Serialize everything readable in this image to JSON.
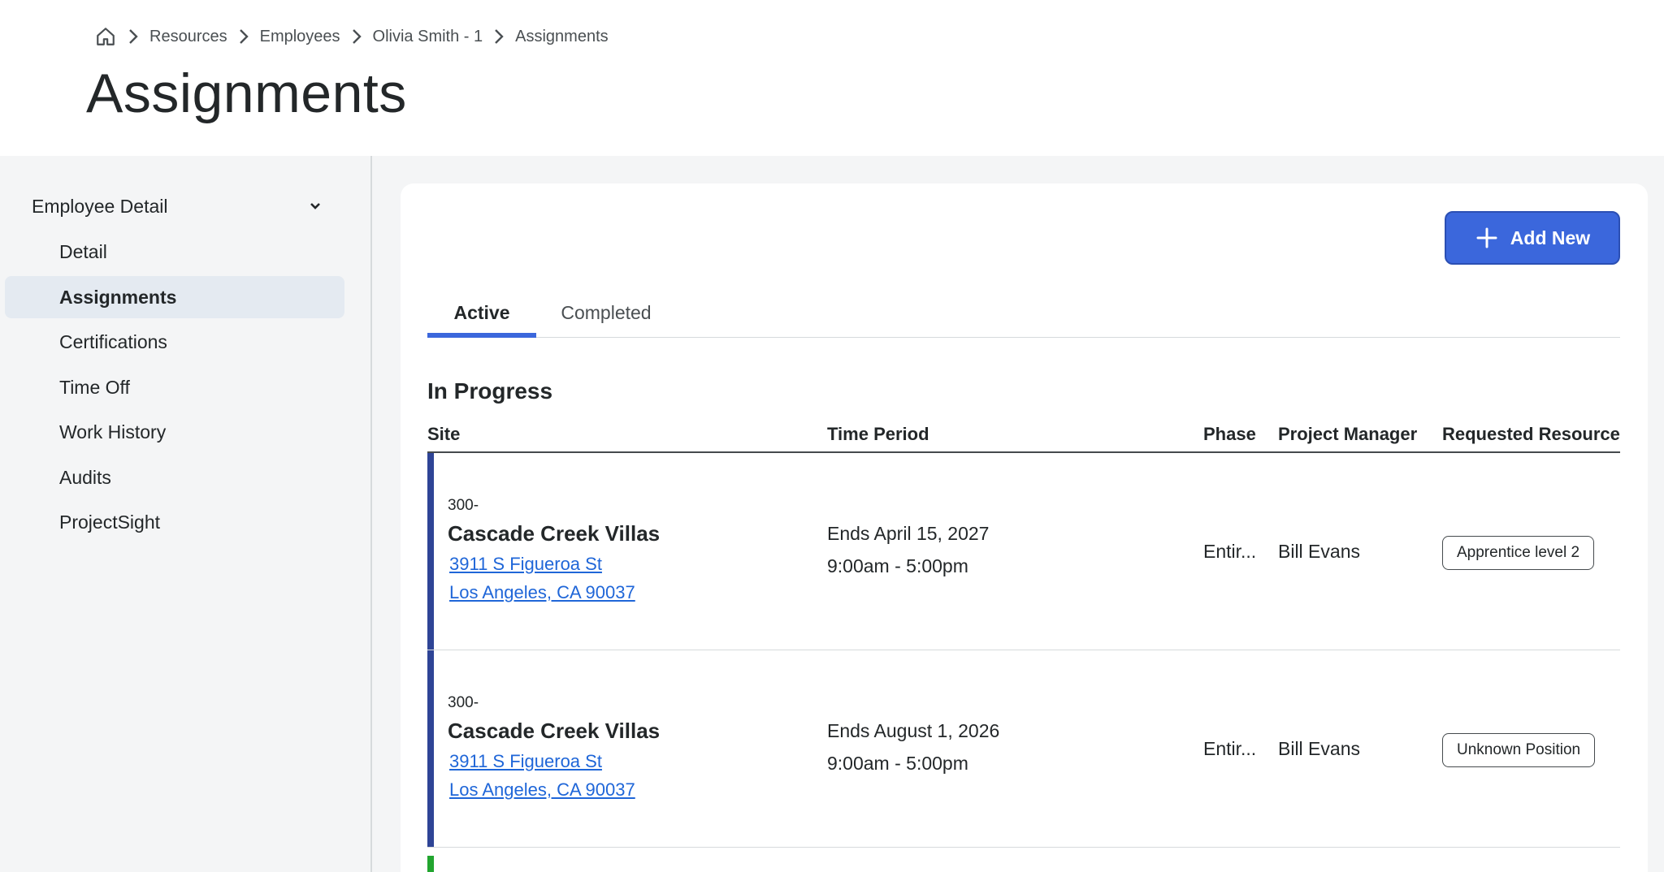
{
  "breadcrumb": {
    "items": [
      "Resources",
      "Employees",
      "Olivia Smith - 1",
      "Assignments"
    ]
  },
  "page": {
    "title": "Assignments"
  },
  "sidebar": {
    "group_label": "Employee Detail",
    "items": [
      {
        "label": "Detail"
      },
      {
        "label": "Assignments",
        "active": true
      },
      {
        "label": "Certifications"
      },
      {
        "label": "Time Off"
      },
      {
        "label": "Work History"
      },
      {
        "label": "Audits"
      },
      {
        "label": "ProjectSight"
      }
    ]
  },
  "actions": {
    "add_new_label": "Add New"
  },
  "tabs": [
    {
      "label": "Active",
      "active": true
    },
    {
      "label": "Completed"
    }
  ],
  "section": {
    "title": "In Progress"
  },
  "table": {
    "columns": [
      "Site",
      "Time Period",
      "Phase",
      "Project Manager",
      "Requested Resource"
    ],
    "rows": [
      {
        "code": "300-",
        "site": "Cascade Creek Villas",
        "address_line1": "3911 S Figueroa St",
        "address_line2": "Los Angeles, CA 90037",
        "ends": "Ends April 15, 2027",
        "hours": "9:00am - 5:00pm",
        "phase": "Entir...",
        "project_manager": "Bill Evans",
        "requested_resource": "Apprentice level 2"
      },
      {
        "code": "300-",
        "site": "Cascade Creek Villas",
        "address_line1": "3911 S Figueroa St",
        "address_line2": "Los Angeles, CA 90037",
        "ends": "Ends August 1, 2026",
        "hours": "9:00am - 5:00pm",
        "phase": "Entir...",
        "project_manager": "Bill Evans",
        "requested_resource": "Unknown Position"
      }
    ]
  },
  "colors": {
    "primary": "#3b67dc",
    "row_accent": "#2e4496",
    "next_row_accent": "#22a52f",
    "link": "#1f66d8",
    "sidebar_active_bg": "#e4eaf1",
    "panel_bg": "#f4f5f6"
  },
  "icons": {
    "home": "home-icon",
    "breadcrumb_separator": "chevron-right-icon",
    "group_toggle": "chevron-down-icon",
    "add": "plus-icon"
  }
}
